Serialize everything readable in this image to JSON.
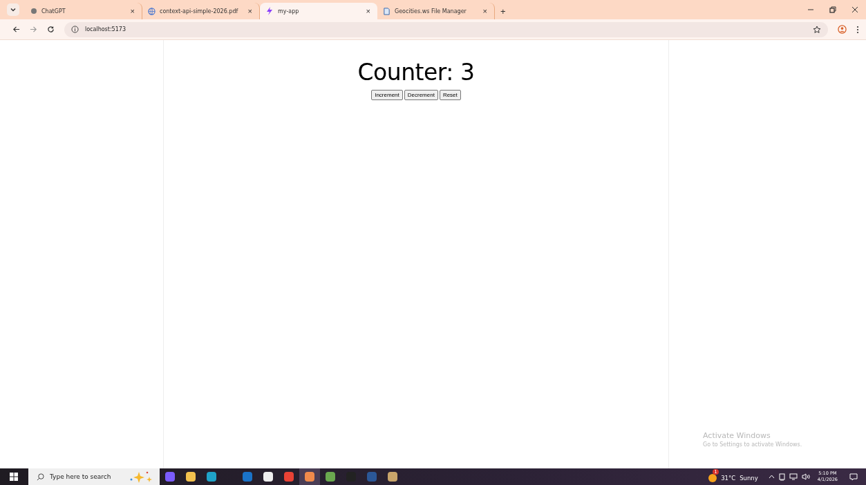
{
  "tabs": [
    {
      "title": "ChatGPT",
      "selected": false,
      "close": "×"
    },
    {
      "title": "context-api-simple-2026.pdf",
      "selected": false,
      "close": "×"
    },
    {
      "title": "my-app",
      "selected": true,
      "close": "×"
    },
    {
      "title": "Geocities.ws File Manager",
      "selected": false,
      "close": "×"
    }
  ],
  "new_tab": "+",
  "address": "localhost:5173",
  "page": {
    "heading": "Counter: 3",
    "buttons": [
      "Increment",
      "Decrement",
      "Reset"
    ]
  },
  "watermark": {
    "title": "Activate Windows",
    "text": "Go to Settings to activate Windows."
  },
  "taskbar": {
    "search_placeholder": "Type here to search",
    "weather_temp": "31°C",
    "weather_text": "Sunny",
    "weather_badge": "1",
    "time": "5:10 PM",
    "date": "4/1/2026"
  }
}
